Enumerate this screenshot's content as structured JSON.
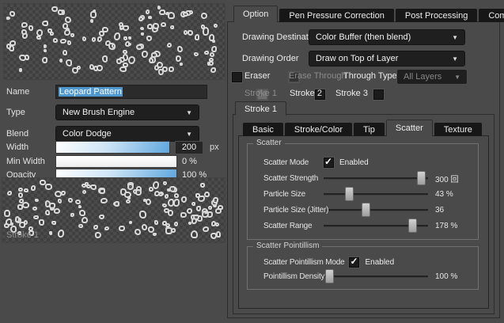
{
  "left": {
    "name": {
      "label": "Name",
      "value": "Leopard Pattern"
    },
    "type": {
      "label": "Type",
      "value": "New Brush Engine"
    },
    "blend": {
      "label": "Blend",
      "value": "Color Dodge"
    },
    "width": {
      "label": "Width",
      "value": "200",
      "unit": "px"
    },
    "min_width": {
      "label": "Min Width",
      "value": "0 %"
    },
    "opacity": {
      "label": "Opacity",
      "value": "100 %"
    },
    "preview_caption": "Stroke 1"
  },
  "tabs": {
    "option": "Option",
    "pen_pressure": "Pen Pressure Correction",
    "post_processing": "Post Processing",
    "compatibility": "Compatibility"
  },
  "option": {
    "drawing_destination": {
      "label": "Drawing Destination",
      "value": "Color Buffer (then blend)"
    },
    "drawing_order": {
      "label": "Drawing Order",
      "value": "Draw on Top of Layer"
    },
    "eraser_label": "Eraser",
    "erase_through_label": "Erase Through",
    "through_type": {
      "label": "Through Type",
      "value": "All Layers"
    },
    "stroke1_label": "Stroke 1",
    "stroke2_label": "Stroke 2",
    "stroke3_label": "Stroke 3",
    "stroke_tab": "Stroke 1",
    "subtabs": {
      "basic": "Basic",
      "stroke_color": "Stroke/Color",
      "tip": "Tip",
      "scatter": "Scatter",
      "texture": "Texture"
    }
  },
  "scatter": {
    "title": "Scatter",
    "mode_label": "Scatter Mode",
    "mode_state": "Enabled",
    "sliders": [
      {
        "label": "Scatter Strength",
        "value": "300 回",
        "pos": 93
      },
      {
        "label": "Particle Size",
        "value": "43 %",
        "pos": 24
      },
      {
        "label": "Particle Size (Jitter)",
        "value": "36",
        "pos": 37
      },
      {
        "label": "Scatter Range",
        "value": "178 %",
        "pos": 85
      }
    ]
  },
  "pointillism": {
    "title": "Scatter Pointillism",
    "mode_label": "Scatter Pointillism Mode",
    "mode_state": "Enabled",
    "slider": {
      "label": "Pointillism Density",
      "value": "100 %",
      "pos": 4
    }
  },
  "checks": {
    "eraser": false,
    "erase_through": false,
    "stroke1": true,
    "stroke2": false,
    "stroke3": false,
    "scatter_mode": true,
    "pointillism_mode": true
  },
  "colors": {
    "accent_blue": "#5ea6de",
    "selection_blue": "#4f97cf",
    "tab_dark": "#171717",
    "panel_gray": "#4a4a4a"
  }
}
